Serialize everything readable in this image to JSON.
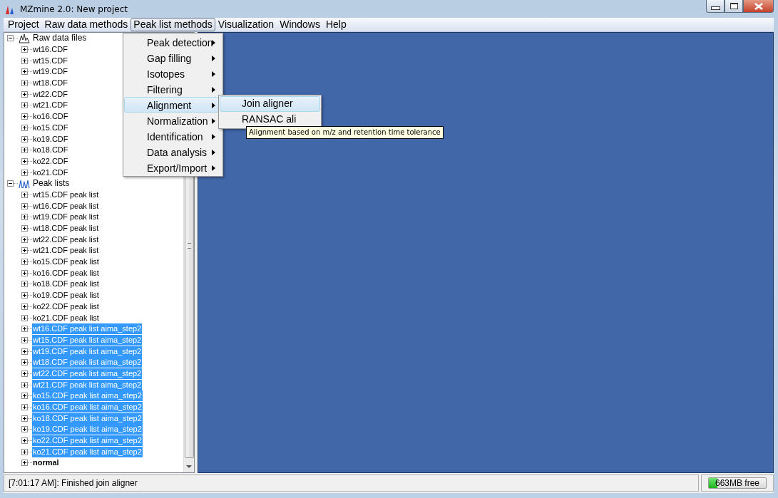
{
  "window": {
    "title": "MZmine 2.0: New project"
  },
  "menubar": [
    {
      "label": "Project",
      "selected": false
    },
    {
      "label": "Raw data methods",
      "selected": false
    },
    {
      "label": "Peak list methods",
      "selected": true
    },
    {
      "label": "Visualization",
      "selected": false
    },
    {
      "label": "Windows",
      "selected": false
    },
    {
      "label": "Help",
      "selected": false
    }
  ],
  "dropdown": {
    "items": [
      {
        "label": "Peak detection",
        "selected": false
      },
      {
        "label": "Gap filling",
        "selected": false
      },
      {
        "label": "Isotopes",
        "selected": false
      },
      {
        "label": "Filtering",
        "selected": false
      },
      {
        "label": "Alignment",
        "selected": true
      },
      {
        "label": "Normalization",
        "selected": false
      },
      {
        "label": "Identification",
        "selected": false
      },
      {
        "label": "Data analysis",
        "selected": false
      },
      {
        "label": "Export/Import",
        "selected": false
      }
    ],
    "submenu": [
      {
        "label": "Join aligner",
        "selected": true
      },
      {
        "label": "RANSAC ali",
        "selected": false
      }
    ],
    "tooltip": "Alignment based on m/z and retention time tolerance"
  },
  "tree": [
    {
      "label": "Raw data files",
      "kind": "raw-files",
      "expanded": true,
      "selected": false,
      "bold": false,
      "children": [
        {
          "label": "wt16.CDF",
          "kind": "file",
          "expanded": false,
          "selected": false,
          "bold": false
        },
        {
          "label": "wt15.CDF",
          "kind": "file",
          "expanded": false,
          "selected": false,
          "bold": false
        },
        {
          "label": "wt19.CDF",
          "kind": "file",
          "expanded": false,
          "selected": false,
          "bold": false
        },
        {
          "label": "wt18.CDF",
          "kind": "file",
          "expanded": false,
          "selected": false,
          "bold": false
        },
        {
          "label": "wt22.CDF",
          "kind": "file",
          "expanded": false,
          "selected": false,
          "bold": false
        },
        {
          "label": "wt21.CDF",
          "kind": "file",
          "expanded": false,
          "selected": false,
          "bold": false
        },
        {
          "label": "ko16.CDF",
          "kind": "file",
          "expanded": false,
          "selected": false,
          "bold": false
        },
        {
          "label": "ko15.CDF",
          "kind": "file",
          "expanded": false,
          "selected": false,
          "bold": false
        },
        {
          "label": "ko19.CDF",
          "kind": "file",
          "expanded": false,
          "selected": false,
          "bold": false
        },
        {
          "label": "ko18.CDF",
          "kind": "file",
          "expanded": false,
          "selected": false,
          "bold": false
        },
        {
          "label": "ko22.CDF",
          "kind": "file",
          "expanded": false,
          "selected": false,
          "bold": false
        },
        {
          "label": "ko21.CDF",
          "kind": "file",
          "expanded": false,
          "selected": false,
          "bold": false
        }
      ]
    },
    {
      "label": "Peak lists",
      "kind": "peak-lists",
      "expanded": true,
      "selected": false,
      "bold": false,
      "children": [
        {
          "label": "wt15.CDF peak list",
          "kind": "file",
          "expanded": false,
          "selected": false,
          "bold": false
        },
        {
          "label": "wt16.CDF peak list",
          "kind": "file",
          "expanded": false,
          "selected": false,
          "bold": false
        },
        {
          "label": "wt19.CDF peak list",
          "kind": "file",
          "expanded": false,
          "selected": false,
          "bold": false
        },
        {
          "label": "wt18.CDF peak list",
          "kind": "file",
          "expanded": false,
          "selected": false,
          "bold": false
        },
        {
          "label": "wt22.CDF peak list",
          "kind": "file",
          "expanded": false,
          "selected": false,
          "bold": false
        },
        {
          "label": "wt21.CDF peak list",
          "kind": "file",
          "expanded": false,
          "selected": false,
          "bold": false
        },
        {
          "label": "ko15.CDF peak list",
          "kind": "file",
          "expanded": false,
          "selected": false,
          "bold": false
        },
        {
          "label": "ko16.CDF peak list",
          "kind": "file",
          "expanded": false,
          "selected": false,
          "bold": false
        },
        {
          "label": "ko18.CDF peak list",
          "kind": "file",
          "expanded": false,
          "selected": false,
          "bold": false
        },
        {
          "label": "ko19.CDF peak list",
          "kind": "file",
          "expanded": false,
          "selected": false,
          "bold": false
        },
        {
          "label": "ko22.CDF peak list",
          "kind": "file",
          "expanded": false,
          "selected": false,
          "bold": false
        },
        {
          "label": "ko21.CDF peak list",
          "kind": "file",
          "expanded": false,
          "selected": false,
          "bold": false
        },
        {
          "label": "wt16.CDF peak list aima_step2",
          "kind": "file",
          "expanded": false,
          "selected": true,
          "bold": false
        },
        {
          "label": "wt15.CDF peak list aima_step2",
          "kind": "file",
          "expanded": false,
          "selected": true,
          "bold": false
        },
        {
          "label": "wt19.CDF peak list aima_step2",
          "kind": "file",
          "expanded": false,
          "selected": true,
          "bold": false
        },
        {
          "label": "wt18.CDF peak list aima_step2",
          "kind": "file",
          "expanded": false,
          "selected": true,
          "bold": false
        },
        {
          "label": "wt22.CDF peak list aima_step2",
          "kind": "file",
          "expanded": false,
          "selected": true,
          "bold": false
        },
        {
          "label": "wt21.CDF peak list aima_step2",
          "kind": "file",
          "expanded": false,
          "selected": true,
          "bold": false
        },
        {
          "label": "ko15.CDF peak list aima_step2",
          "kind": "file",
          "expanded": false,
          "selected": true,
          "bold": false
        },
        {
          "label": "ko16.CDF peak list aima_step2",
          "kind": "file",
          "expanded": false,
          "selected": true,
          "bold": false
        },
        {
          "label": "ko18.CDF peak list aima_step2",
          "kind": "file",
          "expanded": false,
          "selected": true,
          "bold": false
        },
        {
          "label": "ko19.CDF peak list aima_step2",
          "kind": "file",
          "expanded": false,
          "selected": true,
          "bold": false
        },
        {
          "label": "ko22.CDF peak list aima_step2",
          "kind": "file",
          "expanded": false,
          "selected": true,
          "bold": false
        },
        {
          "label": "ko21.CDF peak list aima_step2",
          "kind": "file",
          "expanded": false,
          "selected": true,
          "bold": false
        },
        {
          "label": "normal",
          "kind": "file",
          "expanded": false,
          "selected": false,
          "bold": true
        }
      ]
    }
  ],
  "status_bar": {
    "message": "[7:01:17 AM]: Finished join aligner",
    "memory": {
      "label": "663MB free",
      "level": 0.15
    }
  }
}
